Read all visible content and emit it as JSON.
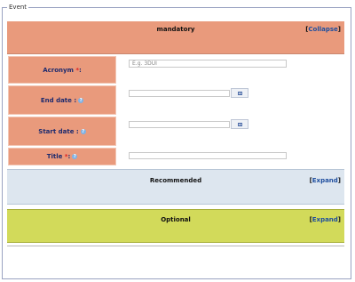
{
  "legend": "Event",
  "sections": {
    "mandatory": {
      "title": "mandatory",
      "toggle": "Collapse"
    },
    "recommended": {
      "title": "Recommended",
      "toggle": "Expand"
    },
    "optional": {
      "title": "Optional",
      "toggle": "Expand"
    }
  },
  "fields": {
    "acronym": {
      "label": "Acronym",
      "required": "*",
      "suffix": ":",
      "placeholder": "E.g. 3DUI"
    },
    "end_date": {
      "label": "End date :",
      "help": "?"
    },
    "start_date": {
      "label": "Start date :",
      "help": "?"
    },
    "title": {
      "label": "Title",
      "required": "*",
      "suffix": ":",
      "help": "?"
    }
  },
  "colors": {
    "mandatory_bg": "#e99a7c",
    "recommended_bg": "#dde6ef",
    "optional_bg": "#d2da5a",
    "link": "#1f4f9f"
  }
}
